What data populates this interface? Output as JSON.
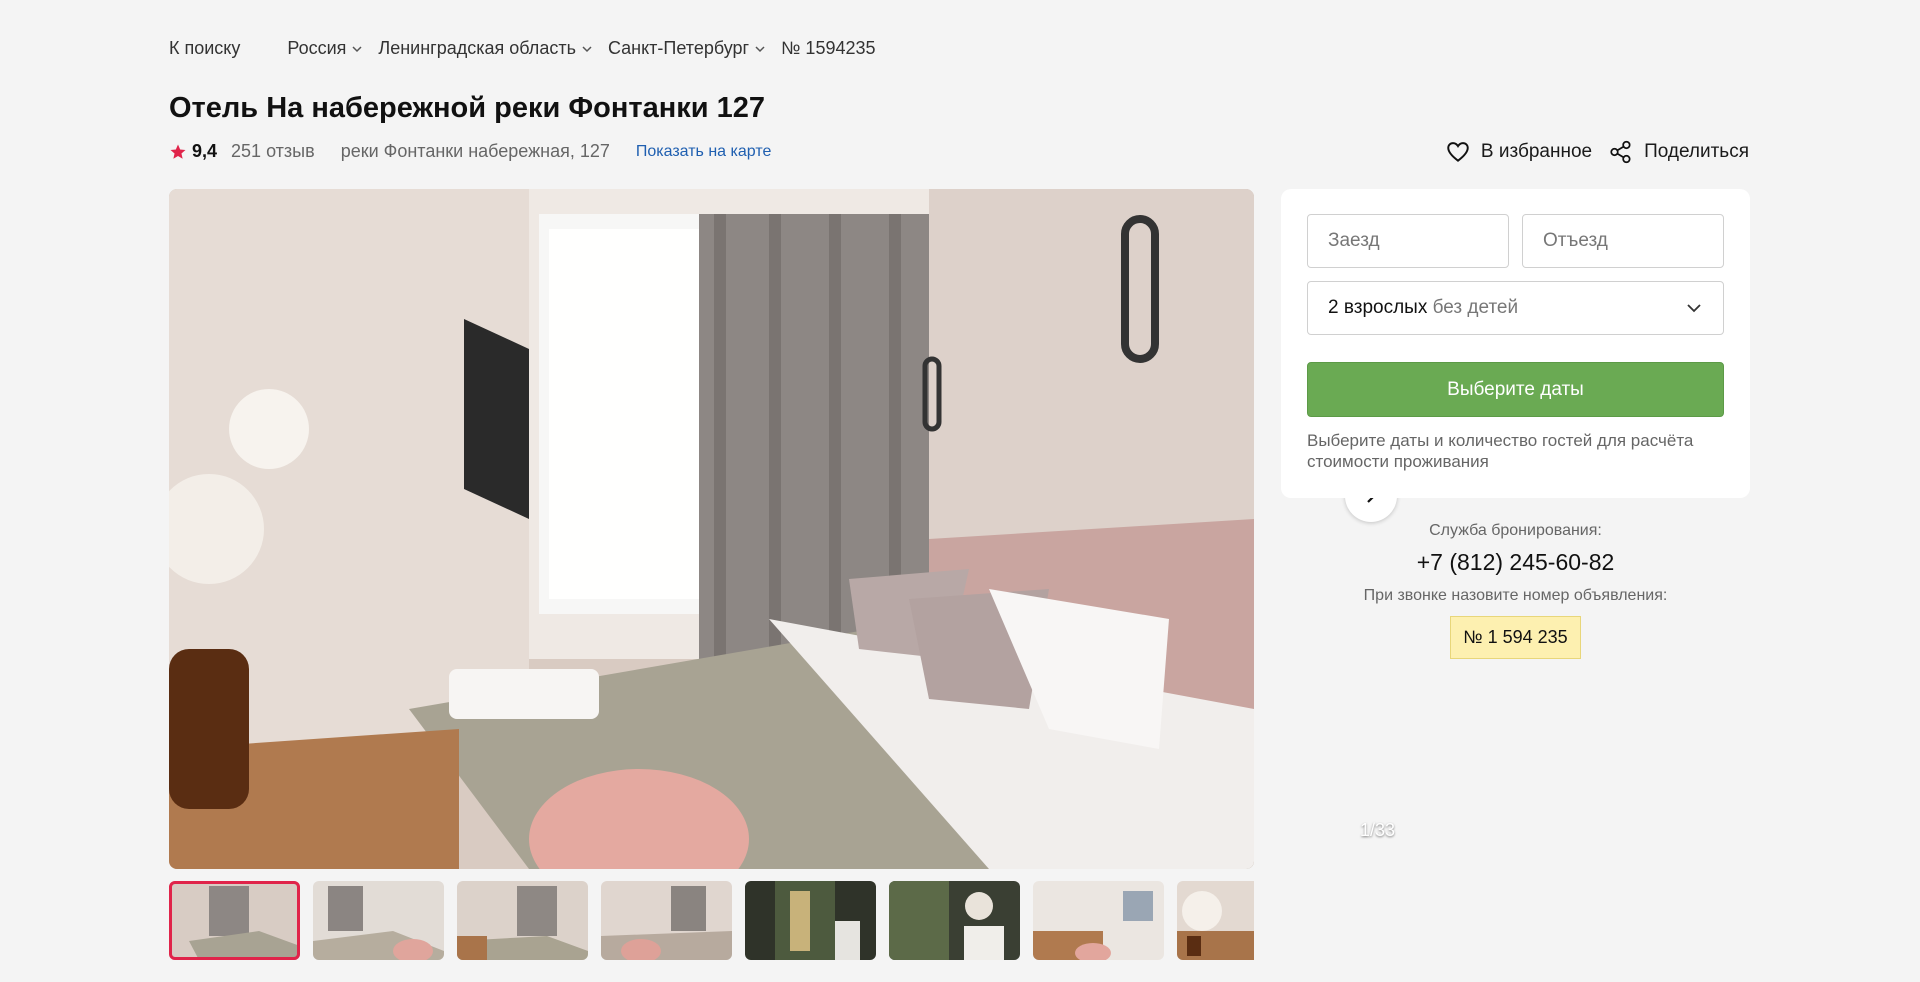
{
  "breadcrumb": {
    "back": "К поиску",
    "items": [
      "Россия",
      "Ленинградская область",
      "Санкт-Петербург"
    ],
    "listing_no": "№ 1594235"
  },
  "hotel": {
    "title": "Отель На набережной реки Фонтанки 127",
    "rating": "9,4",
    "reviews": "251 отзыв",
    "address": "реки Фонтанки набережная, 127",
    "map_link": "Показать на карте"
  },
  "actions": {
    "favorite": "В избранное",
    "share": "Поделиться"
  },
  "gallery": {
    "counter": "1/33",
    "thumb_count": 8
  },
  "booking": {
    "checkin_placeholder": "Заезд",
    "checkout_placeholder": "Отъезд",
    "guests_adults": "2 взрослых",
    "guests_kids": "без детей",
    "cta": "Выберите даты",
    "hint": "Выберите даты и количество гостей для расчёта стоимости проживания"
  },
  "service": {
    "label": "Служба бронирования:",
    "phone": "+7 (812) 245-60-82",
    "call_hint": "При звонке назовите номер объявления:",
    "badge": "№ 1 594 235"
  },
  "colors": {
    "accent_red": "#e0244a",
    "cta_green": "#6aaa53",
    "link_blue": "#1f5fb0",
    "badge_yellow": "#fdf0b0"
  }
}
